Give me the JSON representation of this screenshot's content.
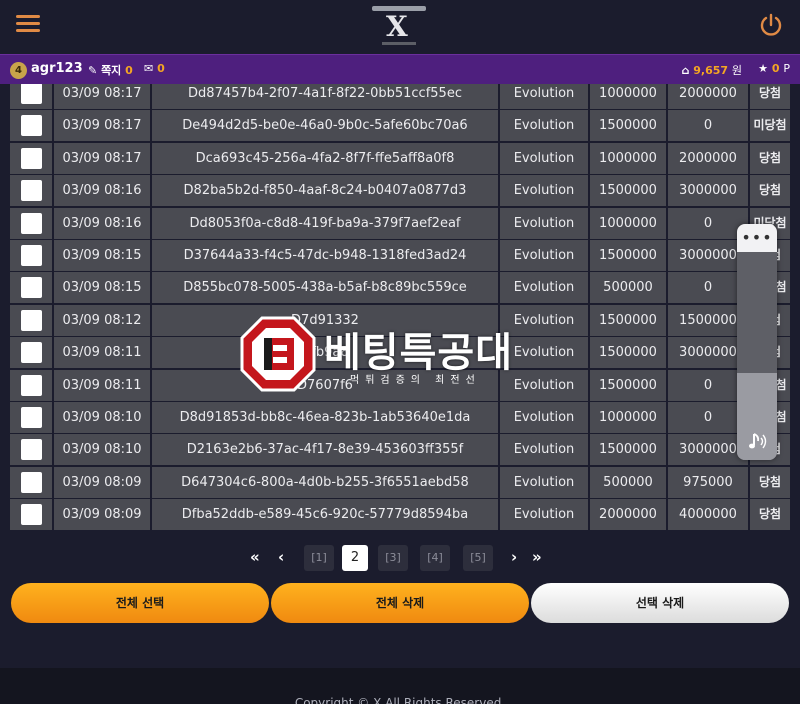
{
  "header": {
    "logo_text": "X"
  },
  "userbar": {
    "level": "4",
    "username": "agr123",
    "notes_label": "쪽지",
    "notes_count": "0",
    "messages_count": "0",
    "money": "9,657",
    "money_unit": "원",
    "points": "0",
    "points_unit": "P"
  },
  "table": {
    "rows": [
      {
        "time": "03/09 08:17",
        "id": "Dd87457b4-2f07-4a1f-8f22-0bb51ccf55ec",
        "game": "Evolution",
        "bet": "1000000",
        "win": "2000000",
        "result": "당첨"
      },
      {
        "time": "03/09 08:17",
        "id": "De494d2d5-be0e-46a0-9b0c-5afe60bc70a6",
        "game": "Evolution",
        "bet": "1500000",
        "win": "0",
        "result": "미당첨"
      },
      {
        "time": "03/09 08:17",
        "id": "Dca693c45-256a-4fa2-8f7f-ffe5aff8a0f8",
        "game": "Evolution",
        "bet": "1000000",
        "win": "2000000",
        "result": "당첨"
      },
      {
        "time": "03/09 08:16",
        "id": "D82ba5b2d-f850-4aaf-8c24-b0407a0877d3",
        "game": "Evolution",
        "bet": "1500000",
        "win": "3000000",
        "result": "당첨"
      },
      {
        "time": "03/09 08:16",
        "id": "Dd8053f0a-c8d8-419f-ba9a-379f7aef2eaf",
        "game": "Evolution",
        "bet": "1000000",
        "win": "0",
        "result": "미당첨"
      },
      {
        "time": "03/09 08:15",
        "id": "D37644a33-f4c5-47dc-b948-1318fed3ad24",
        "game": "Evolution",
        "bet": "1500000",
        "win": "3000000",
        "result": "당첨"
      },
      {
        "time": "03/09 08:15",
        "id": "D855bc078-5005-438a-b5af-b8c89bc559ce",
        "game": "Evolution",
        "bet": "500000",
        "win": "0",
        "result": "미당첨"
      },
      {
        "time": "03/09 08:12",
        "id": "D7d91332",
        "game": "Evolution",
        "bet": "1500000",
        "win": "1500000",
        "result": "당첨"
      },
      {
        "time": "03/09 08:11",
        "id": "Dfb9a8",
        "game": "Evolution",
        "bet": "1500000",
        "win": "3000000",
        "result": "당첨"
      },
      {
        "time": "03/09 08:11",
        "id": "D7607f6",
        "game": "Evolution",
        "bet": "1500000",
        "win": "0",
        "result": "미당첨"
      },
      {
        "time": "03/09 08:10",
        "id": "D8d91853d-bb8c-46ea-823b-1ab53640e1da",
        "game": "Evolution",
        "bet": "1000000",
        "win": "0",
        "result": "미당첨"
      },
      {
        "time": "03/09 08:10",
        "id": "D2163e2b6-37ac-4f17-8e39-453603ff355f",
        "game": "Evolution",
        "bet": "1500000",
        "win": "3000000",
        "result": "당첨"
      },
      {
        "time": "03/09 08:09",
        "id": "D647304c6-800a-4d0b-b255-3f6551aebd58",
        "game": "Evolution",
        "bet": "500000",
        "win": "975000",
        "result": "당첨"
      },
      {
        "time": "03/09 08:09",
        "id": "Dfba52ddb-e589-45c6-920c-57779d8594ba",
        "game": "Evolution",
        "bet": "2000000",
        "win": "4000000",
        "result": "당첨"
      }
    ]
  },
  "pagination": {
    "first": "«",
    "prev": "‹",
    "pages": [
      "[1]",
      "2",
      "[3]",
      "[4]",
      "[5]"
    ],
    "active_index": 1,
    "next": "›",
    "last": "»"
  },
  "actions": {
    "select_all": "전체 선택",
    "delete_all": "전체 삭제",
    "delete_selected": "선택 삭제"
  },
  "watermark": {
    "title": "베팅특공대",
    "subtitle": "먹튀검증의 최전선"
  },
  "float_panel": {
    "more": "•••",
    "volume": 0.42
  },
  "footer": {
    "copyright": "Copyright © X All Rights Reserved."
  },
  "colors": {
    "accent": "#f5a623",
    "userbar": "#4e1f7e",
    "cell": "#4a4b52",
    "background": "#1b1c2d"
  }
}
